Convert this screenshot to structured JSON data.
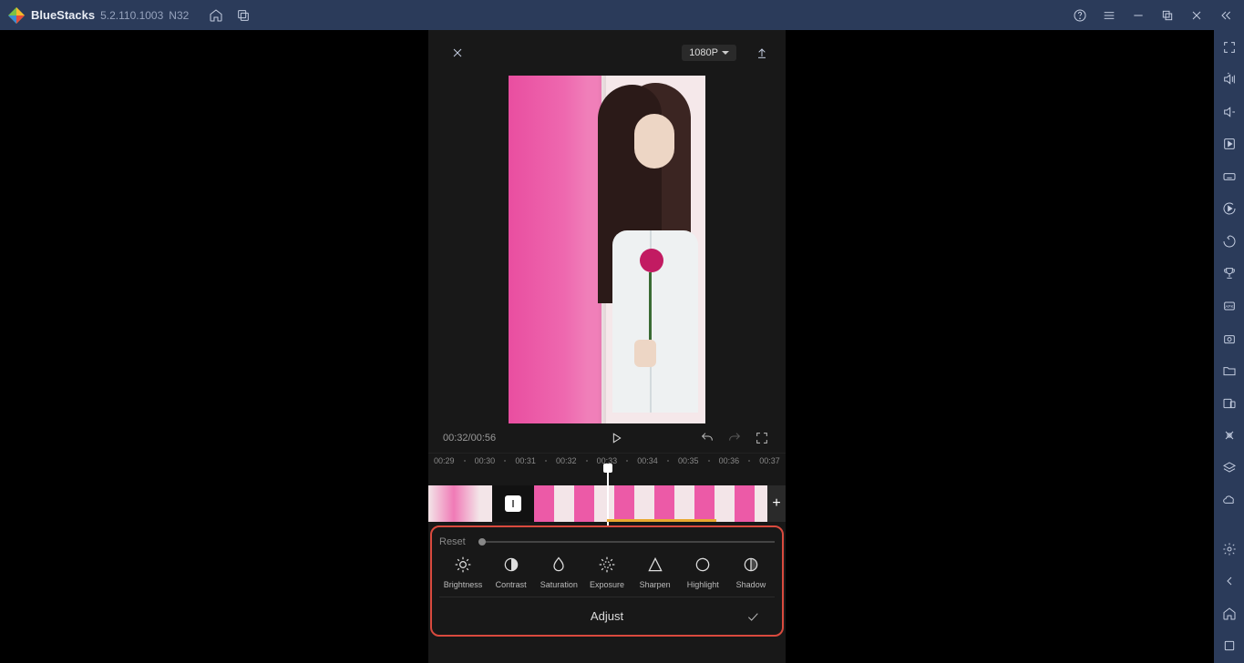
{
  "titlebar": {
    "app_name": "BlueStacks",
    "version": "5.2.110.1003",
    "nver": "N32"
  },
  "editor": {
    "resolution": "1080P",
    "time_current": "00:32",
    "time_total": "00:56",
    "ruler": [
      "00:29",
      "00:30",
      "00:31",
      "00:32",
      "00:33",
      "00:34",
      "00:35",
      "00:36",
      "00:37"
    ]
  },
  "adjust": {
    "reset": "Reset",
    "title": "Adjust",
    "items": [
      {
        "label": "Brightness"
      },
      {
        "label": "Contrast"
      },
      {
        "label": "Saturation"
      },
      {
        "label": "Exposure"
      },
      {
        "label": "Sharpen"
      },
      {
        "label": "Highlight"
      },
      {
        "label": "Shadow"
      }
    ]
  }
}
